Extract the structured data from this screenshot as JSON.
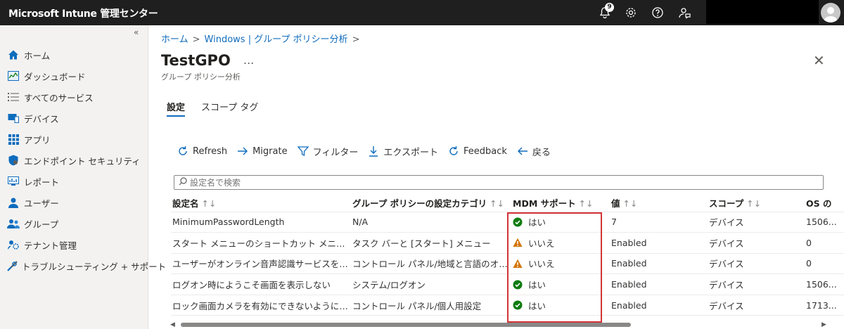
{
  "app": {
    "title": "Microsoft Intune 管理センター",
    "notification_count": "9"
  },
  "sidebar": {
    "collapse": "«",
    "items": [
      {
        "label": "ホーム",
        "icon": "home-icon"
      },
      {
        "label": "ダッシュボード",
        "icon": "dashboard-icon"
      },
      {
        "label": "すべてのサービス",
        "icon": "list-icon"
      },
      {
        "label": "デバイス",
        "icon": "devices-icon"
      },
      {
        "label": "アプリ",
        "icon": "apps-icon"
      },
      {
        "label": "エンドポイント セキュリティ",
        "icon": "shield-icon"
      },
      {
        "label": "レポート",
        "icon": "reports-icon"
      },
      {
        "label": "ユーザー",
        "icon": "user-icon"
      },
      {
        "label": "グループ",
        "icon": "group-icon"
      },
      {
        "label": "テナント管理",
        "icon": "tenant-icon"
      },
      {
        "label": "トラブルシューティング + サポート",
        "icon": "tools-icon"
      }
    ]
  },
  "breadcrumb": {
    "home": "ホーム",
    "page": "Windows | グループ ポリシー分析"
  },
  "page": {
    "title": "TestGPO",
    "more": "...",
    "subtitle": "グループ ポリシー分析",
    "close": "✕"
  },
  "tabs": [
    {
      "label": "設定"
    },
    {
      "label": "スコープ タグ"
    }
  ],
  "toolbar": {
    "refresh": "Refresh",
    "migrate": "Migrate",
    "filter": "フィルター",
    "export": "エクスポート",
    "feedback": "Feedback",
    "back": "戻る"
  },
  "search": {
    "placeholder": "設定名で検索"
  },
  "table": {
    "sort_glyph": "↑↓",
    "columns": [
      "設定名",
      "グループ ポリシーの設定カテゴリ",
      "MDM サポート",
      "値",
      "スコープ",
      "OS の"
    ],
    "rows": [
      {
        "name": "MinimumPasswordLength",
        "category": "N/A",
        "mdm": "はい",
        "mdm_status": "ok",
        "value": "7",
        "scope": "デバイス",
        "os": "1506..."
      },
      {
        "name": "スタート メニューのショートカット メニューを無効にする",
        "category": "タスク バーと [スタート] メニュー",
        "mdm": "いいえ",
        "mdm_status": "warn",
        "value": "Enabled",
        "scope": "デバイス",
        "os": "0"
      },
      {
        "name": "ユーザーがオンライン音声認識サービスを有効にで…",
        "category": "コントロール パネル/地域と言語のオプション",
        "mdm": "いいえ",
        "mdm_status": "warn",
        "value": "Enabled",
        "scope": "デバイス",
        "os": "0"
      },
      {
        "name": "ログオン時にようこそ画面を表示しない",
        "category": "システム/ログオン",
        "mdm": "はい",
        "mdm_status": "ok",
        "value": "Enabled",
        "scope": "デバイス",
        "os": "1506..."
      },
      {
        "name": "ロック画面カメラを有効にできないようにする",
        "category": "コントロール パネル/個人用設定",
        "mdm": "はい",
        "mdm_status": "ok",
        "value": "Enabled",
        "scope": "デバイス",
        "os": "1713..."
      }
    ]
  },
  "colors": {
    "accent": "#0f6cbd",
    "ok": "#107c10",
    "warn": "#d47500",
    "highlight": "#d13438",
    "topbar": "#1f1f1f"
  }
}
